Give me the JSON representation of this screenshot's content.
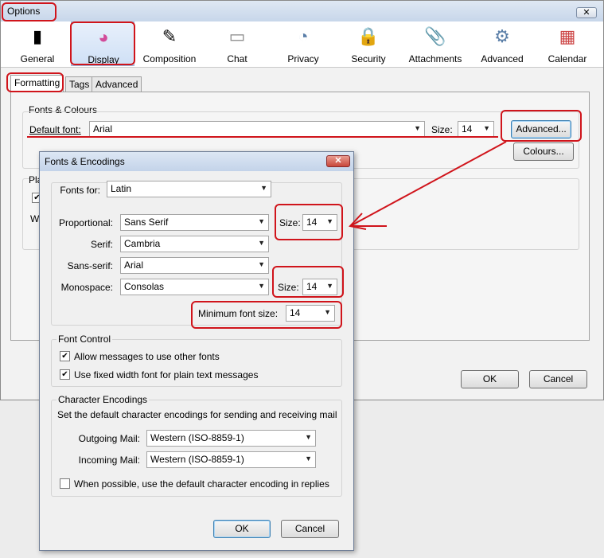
{
  "options_window": {
    "title": "Options",
    "close_glyph": "✕",
    "panes": [
      {
        "label": "General",
        "icon": "switch-icon",
        "glyph": "▮"
      },
      {
        "label": "Display",
        "icon": "color-wheel-icon",
        "glyph": "◕"
      },
      {
        "label": "Composition",
        "icon": "pencil-document-icon",
        "glyph": "✎"
      },
      {
        "label": "Chat",
        "icon": "speech-bubble-icon",
        "glyph": "▭"
      },
      {
        "label": "Privacy",
        "icon": "mask-icon",
        "glyph": "◔"
      },
      {
        "label": "Security",
        "icon": "padlock-icon",
        "glyph": "🔒"
      },
      {
        "label": "Attachments",
        "icon": "paperclip-icon",
        "glyph": "📎"
      },
      {
        "label": "Advanced",
        "icon": "gear-icon",
        "glyph": "⚙"
      },
      {
        "label": "Calendar",
        "icon": "calendar-icon",
        "glyph": "▦"
      }
    ],
    "tabs": [
      "Formatting",
      "Tags",
      "Advanced"
    ],
    "fonts_colours": {
      "group_label": "Fonts & Colours",
      "default_font_label": "Default font:",
      "default_font_value": "Arial",
      "size_label": "Size:",
      "size_value": "14",
      "advanced_button": "Advanced...",
      "colours_button": "Colours..."
    },
    "plain_text_fragment": "Pla",
    "wh_fragment": "Wl",
    "ok_button": "OK",
    "cancel_button": "Cancel"
  },
  "fonts_dialog": {
    "title": "Fonts & Encodings",
    "close_glyph": "✕",
    "fonts_for_label": "Fonts for:",
    "fonts_for_value": "Latin",
    "proportional_label": "Proportional:",
    "proportional_value": "Sans Serif",
    "serif_label": "Serif:",
    "serif_value": "Cambria",
    "sans_serif_label": "Sans-serif:",
    "sans_serif_value": "Arial",
    "monospace_label": "Monospace:",
    "monospace_value": "Consolas",
    "size_label": "Size:",
    "proportional_size": "14",
    "monospace_size": "14",
    "min_font_size_label": "Minimum font size:",
    "min_font_size_value": "14",
    "font_control": {
      "group_label": "Font Control",
      "allow_other_fonts": "Allow messages to use other fonts",
      "fixed_width": "Use fixed width font for plain text messages"
    },
    "encodings": {
      "group_label": "Character Encodings",
      "description": "Set the default character encodings for sending and receiving mail",
      "outgoing_label": "Outgoing Mail:",
      "outgoing_value": "Western (ISO-8859-1)",
      "incoming_label": "Incoming Mail:",
      "incoming_value": "Western (ISO-8859-1)",
      "reply_default": "When possible, use the default character encoding in replies"
    },
    "ok_button": "OK",
    "cancel_button": "Cancel"
  },
  "colors": {
    "annotation_red": "#d0141b"
  }
}
